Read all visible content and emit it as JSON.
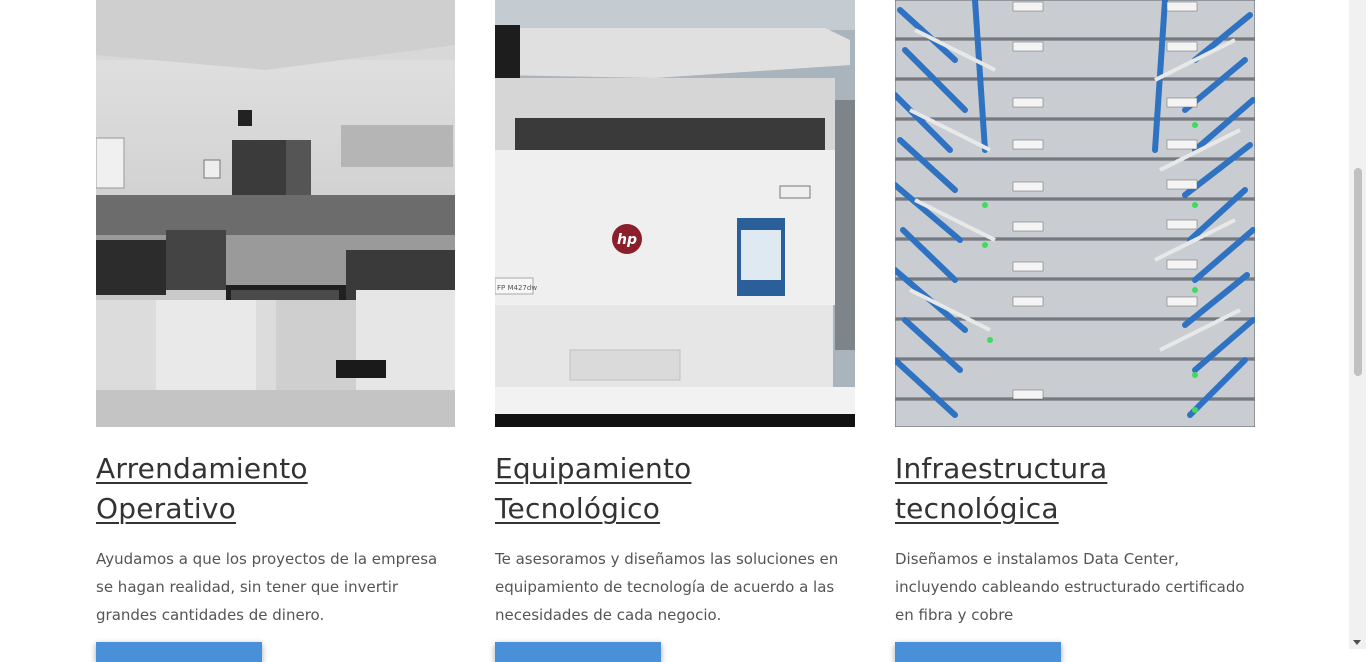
{
  "cards": [
    {
      "title_line1": "Arrendamiento",
      "title_line2": "Operativo",
      "desc_lines": [
        "Ayudamos a que los proyectos de la empresa",
        "se hagan realidad, sin tener que invertir",
        "grandes cantidades de dinero."
      ]
    },
    {
      "title_line1": "Equipamiento",
      "title_line2": "Tecnológico",
      "desc_lines": [
        "Te asesoramos y diseñamos las soluciones en",
        "equipamiento de tecnología de acuerdo a las",
        "necesidades de cada negocio."
      ],
      "printer_brand": "hp",
      "printer_model": "FP M427dw"
    },
    {
      "title_line1": "Infraestructura",
      "title_line2": "tecnológica",
      "desc_lines": [
        "Diseñamos e instalamos Data Center,",
        "incluyendo cableando estructurado certificado",
        "en fibra  y cobre"
      ]
    }
  ],
  "colors": {
    "button_blue": "#4a90d9",
    "title_text": "#333333",
    "body_text": "#555555"
  }
}
